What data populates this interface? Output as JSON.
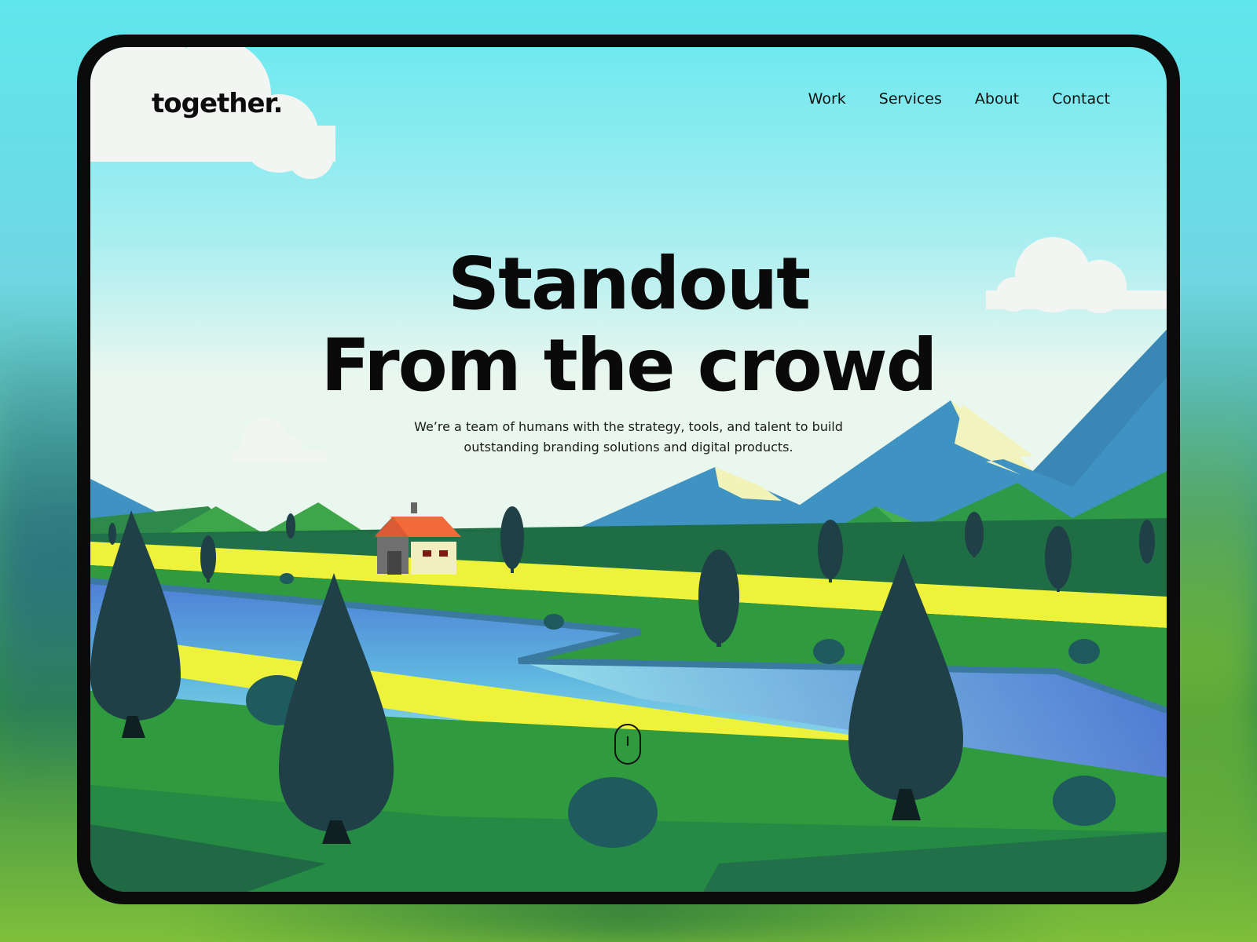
{
  "brand": {
    "logo": "together."
  },
  "nav": {
    "items": [
      "Work",
      "Services",
      "About",
      "Contact"
    ]
  },
  "hero": {
    "title_line1": "Standout",
    "title_line2": "From the crowd",
    "subtitle_line1": "We’re a team of humans with the strategy, tools, and talent to build",
    "subtitle_line2": "outstanding branding solutions and digital products."
  },
  "colors": {
    "sky_top": "#6fe9ef",
    "sky_bottom": "#e9f7ee",
    "mountain_blue": "#3f93c2",
    "grass": "#2f9b3e",
    "dark_green": "#22704a",
    "yellow_path": "#eef23a",
    "river": "#4a7fd4",
    "tree": "#1f4046",
    "device_frame": "#0b0b0b"
  }
}
